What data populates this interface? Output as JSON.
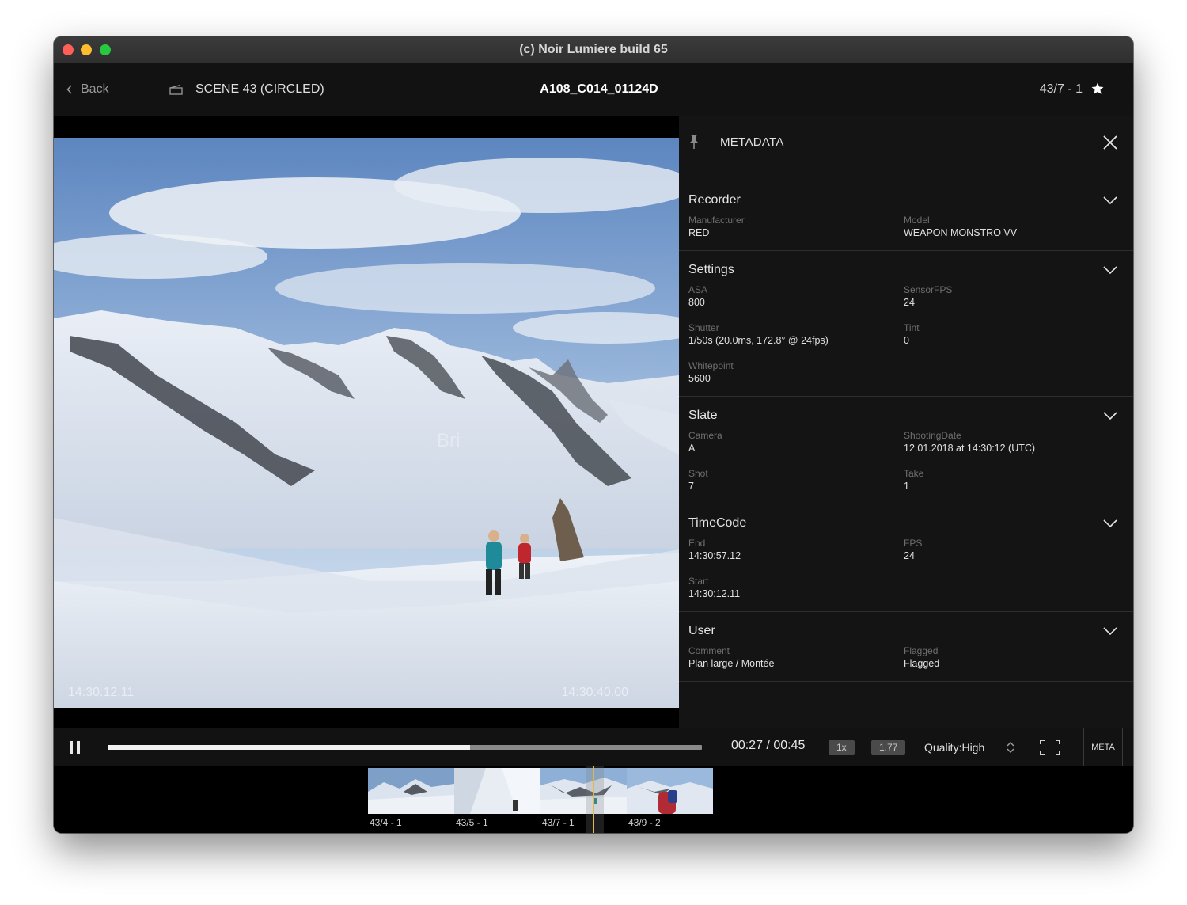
{
  "window": {
    "title": "(c) Noir Lumiere build 65"
  },
  "topbar": {
    "back_label": "Back",
    "scene_label": "SCENE 43 (CIRCLED)",
    "clip_name": "A108_C014_01124D",
    "take_id": "43/7 - 1"
  },
  "video": {
    "timecode_in": "14:30:12.11",
    "timecode_out": "14:30:40.00",
    "watermark": "Bri"
  },
  "metadata": {
    "title": "METADATA",
    "sections": [
      {
        "title": "Recorder",
        "fields": [
          {
            "label": "Manufacturer",
            "value": "RED"
          },
          {
            "label": "Model",
            "value": "WEAPON MONSTRO VV"
          }
        ]
      },
      {
        "title": "Settings",
        "fields": [
          {
            "label": "ASA",
            "value": "800"
          },
          {
            "label": "SensorFPS",
            "value": "24"
          },
          {
            "label": "Shutter",
            "value": "1/50s (20.0ms, 172.8° @ 24fps)"
          },
          {
            "label": "Tint",
            "value": "0"
          },
          {
            "label": "Whitepoint",
            "value": "5600"
          }
        ]
      },
      {
        "title": "Slate",
        "fields": [
          {
            "label": "Camera",
            "value": "A"
          },
          {
            "label": "ShootingDate",
            "value": "12.01.2018 at 14:30:12 (UTC)"
          },
          {
            "label": "Shot",
            "value": "7"
          },
          {
            "label": "Take",
            "value": "1"
          }
        ]
      },
      {
        "title": "TimeCode",
        "fields": [
          {
            "label": "End",
            "value": "14:30:57.12"
          },
          {
            "label": "FPS",
            "value": "24"
          },
          {
            "label": "Start",
            "value": "14:30:12.11"
          }
        ]
      },
      {
        "title": "User",
        "fields": [
          {
            "label": "Comment",
            "value": "Plan large / Montée"
          },
          {
            "label": "Flagged",
            "value": "Flagged"
          }
        ]
      }
    ]
  },
  "controls": {
    "progress": 0.61,
    "time_display": "00:27 / 00:45",
    "speed": "1x",
    "aspect": "1.77",
    "quality": "Quality:High",
    "meta_button": "META"
  },
  "filmstrip": {
    "thumbnails": [
      {
        "label": "43/4 - 1"
      },
      {
        "label": "43/5 - 1"
      },
      {
        "label": "43/7 - 1"
      },
      {
        "label": "43/9 - 2"
      }
    ]
  },
  "colors": {
    "background": "#111111",
    "panel": "#141414",
    "playhead": "#e0b94a",
    "star": "#ffffff"
  }
}
